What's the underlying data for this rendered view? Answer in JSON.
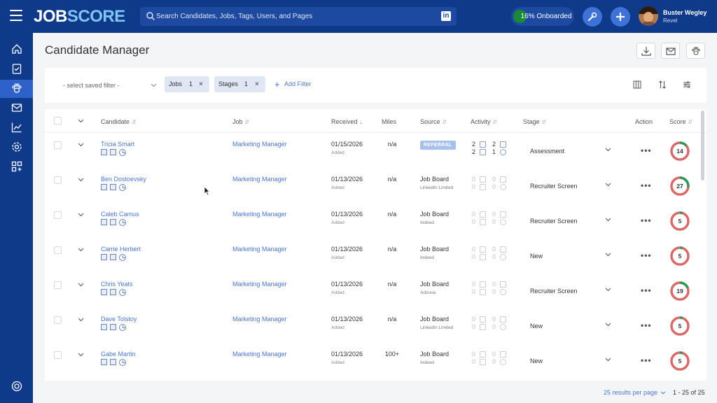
{
  "app": {
    "logo_part1": "JOB",
    "logo_part2": "SCORE",
    "search_placeholder": "Search Candidates, Jobs, Tags, Users, and Pages",
    "linkedin_label": "in",
    "onboarded_label": "16% Onboarded",
    "onboarded_fraction": 0.16,
    "user": {
      "name": "Buster Wegley",
      "org": "Revel"
    }
  },
  "sidebar": {
    "items": [
      {
        "name": "home-icon"
      },
      {
        "name": "clipboard-check-icon"
      },
      {
        "name": "paw-icon",
        "active": true
      },
      {
        "name": "mail-icon"
      },
      {
        "name": "chart-icon"
      },
      {
        "name": "gear-icon"
      },
      {
        "name": "apps-icon"
      }
    ],
    "bottom": {
      "name": "help-lifebuoy-icon"
    }
  },
  "page": {
    "title": "Candidate Manager",
    "header_icons": [
      "download-icon",
      "email-icon",
      "paw-icon"
    ]
  },
  "filters": {
    "saved_filter_placeholder": "- select saved filter -",
    "chips": [
      {
        "label": "Jobs",
        "count": "1",
        "remove": "×"
      },
      {
        "label": "Stages",
        "count": "1",
        "remove": "×"
      }
    ],
    "add_filter_label": "Add Filter",
    "add_filter_icon": "+",
    "toolbar_icons": [
      "columns-icon",
      "sort-icon",
      "sliders-icon"
    ]
  },
  "table": {
    "columns": [
      "Candidate",
      "Job",
      "Received",
      "Miles",
      "Source",
      "Activity",
      "Stage",
      "Action",
      "Score"
    ],
    "action_glyph": "•••",
    "rows": [
      {
        "name": "Tricia Smart",
        "job": "Marketing Manager",
        "received": "01/15/2026",
        "received_sub": "Added",
        "miles": "n/a",
        "source": "",
        "source_badge": "REFERRAL",
        "source_sub": "",
        "activity": [
          "2",
          "2",
          "2",
          "1"
        ],
        "activity_active": true,
        "stage": "Assessment",
        "score": 14,
        "score_color": "#d04a4a"
      },
      {
        "name": "Ben Dostoevsky",
        "job": "Marketing Manager",
        "received": "01/13/2026",
        "received_sub": "Added",
        "miles": "n/a",
        "source": "Job Board",
        "source_badge": "",
        "source_sub": "LinkedIn Limited",
        "activity": [
          "0",
          "0",
          "0",
          "0"
        ],
        "activity_active": false,
        "stage": "Recruiter Screen",
        "score": 27,
        "score_color": "#d04a4a"
      },
      {
        "name": "Caleb Camus",
        "job": "Marketing Manager",
        "received": "01/13/2026",
        "received_sub": "Added",
        "miles": "n/a",
        "source": "Job Board",
        "source_badge": "",
        "source_sub": "Indeed",
        "activity": [
          "0",
          "0",
          "0",
          "0"
        ],
        "activity_active": false,
        "stage": "Recruiter Screen",
        "score": 5,
        "score_color": "#d04a4a"
      },
      {
        "name": "Carrie Herbert",
        "job": "Marketing Manager",
        "received": "01/13/2026",
        "received_sub": "Added",
        "miles": "n/a",
        "source": "Job Board",
        "source_badge": "",
        "source_sub": "Indeed",
        "activity": [
          "0",
          "0",
          "0",
          "0"
        ],
        "activity_active": false,
        "stage": "New",
        "score": 5,
        "score_color": "#d04a4a"
      },
      {
        "name": "Chris Yeats",
        "job": "Marketing Manager",
        "received": "01/13/2026",
        "received_sub": "Added",
        "miles": "n/a",
        "source": "Job Board",
        "source_badge": "",
        "source_sub": "Adzuna",
        "activity": [
          "0",
          "0",
          "0",
          "0"
        ],
        "activity_active": false,
        "stage": "Recruiter Screen",
        "score": 19,
        "score_color": "#d04a4a"
      },
      {
        "name": "Dave Tolstoy",
        "job": "Marketing Manager",
        "received": "01/13/2026",
        "received_sub": "Added",
        "miles": "n/a",
        "source": "Job Board",
        "source_badge": "",
        "source_sub": "LinkedIn Limited",
        "activity": [
          "0",
          "0",
          "0",
          "0"
        ],
        "activity_active": false,
        "stage": "New",
        "score": 5,
        "score_color": "#d04a4a"
      },
      {
        "name": "Gabe Martin",
        "job": "Marketing Manager",
        "received": "01/13/2026",
        "received_sub": "Added",
        "miles": "100+",
        "source": "Job Board",
        "source_badge": "",
        "source_sub": "Indeed",
        "activity": [
          "0",
          "0",
          "0",
          "0"
        ],
        "activity_active": false,
        "stage": "New",
        "score": 5,
        "score_color": "#d04a4a"
      }
    ]
  },
  "footer": {
    "per_page": "25 results per page",
    "range": "1 - 25 of 25"
  },
  "colors": {
    "brand_navy": "#0f3a8a",
    "accent_blue": "#4a77c9",
    "score_green": "#2e9a5a",
    "score_red": "#d96a6a"
  }
}
